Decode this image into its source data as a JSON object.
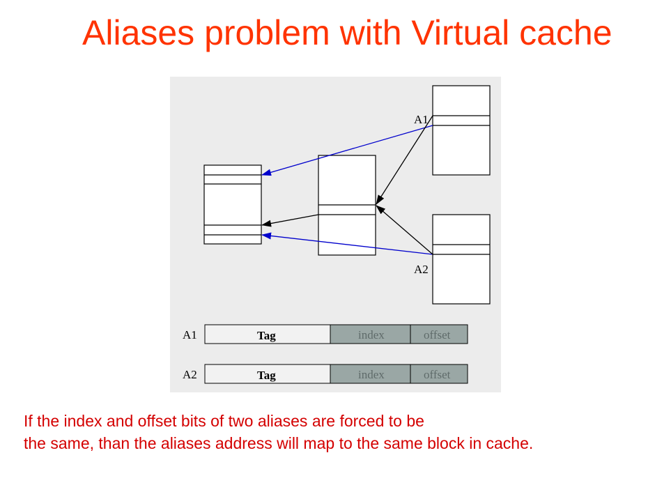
{
  "title": "Aliases problem with Virtual cache",
  "diagram": {
    "label_a1": "A1",
    "label_a2": "A2",
    "address_rows": [
      {
        "name": "A1",
        "fields": [
          "Tag",
          "index",
          "offset"
        ]
      },
      {
        "name": "A2",
        "fields": [
          "Tag",
          "index",
          "offset"
        ]
      }
    ],
    "colors": {
      "arrow_blue": "#0000cc",
      "arrow_black": "#000000",
      "field_grey": "#9aa7a5",
      "background": "#ececec"
    }
  },
  "caption": {
    "line1": "If  the index and offset bits of two aliases are forced to be",
    "line2": "the same, than the aliases address will map to the same block in cache."
  }
}
